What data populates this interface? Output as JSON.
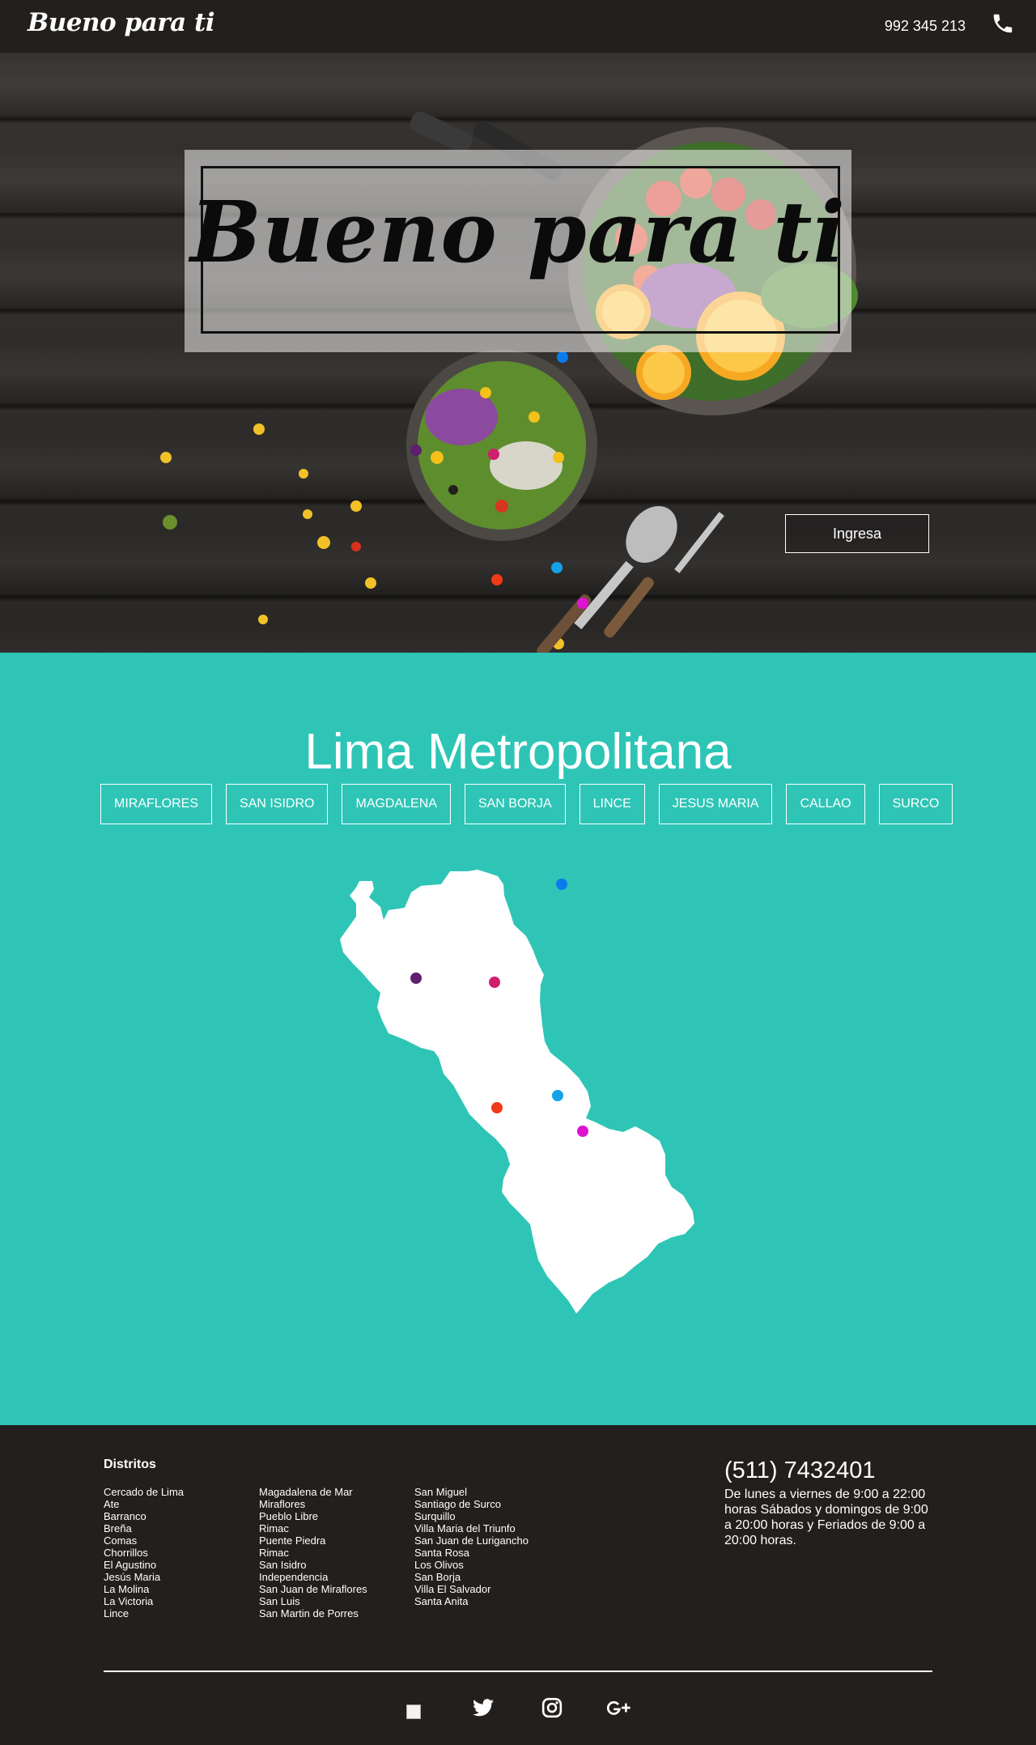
{
  "header": {
    "brand": "Bueno para ti",
    "phone": "992 345 213",
    "phone_icon": "phone-icon"
  },
  "hero": {
    "title": "Bueno para ti",
    "cta_label": "Ingresa"
  },
  "lima": {
    "title": "Lima Metropolitana",
    "districts": [
      "MIRAFLORES",
      "SAN ISIDRO",
      "MAGDALENA",
      "SAN BORJA",
      "LINCE",
      "JESUS MARIA",
      "CALLAO",
      "SURCO"
    ],
    "marker_colors": [
      "#0a7bea",
      "#5e1f6e",
      "#d01f6b",
      "#f03a17",
      "#14a3e8",
      "#e012d2"
    ],
    "background": "#2ec5b6"
  },
  "footer": {
    "heading": "Distritos",
    "columns": [
      [
        "Cercado de Lima",
        "Ate",
        "Barranco",
        "Breña",
        "Comas",
        "Chorrillos",
        "El Agustino",
        "Jesús Maria",
        "La Molina",
        "La Victoria",
        "Lince"
      ],
      [
        "Magadalena de Mar",
        "Miraflores",
        "Pueblo Libre",
        "Rimac",
        "Puente Piedra",
        "Rimac",
        "San Isidro",
        "Independencia",
        "San Juan de Miraflores",
        "San Luis",
        "San Martin de Porres"
      ],
      [
        "San Miguel",
        "Santiago de Surco",
        "Surquillo",
        "Villa Maria del Triunfo",
        "San Juan de Lurigancho",
        "Santa Rosa",
        "Los Olivos",
        "San Borja",
        "Villa El Salvador",
        "Santa Anita"
      ]
    ],
    "contact_phone": "(511) 7432401",
    "contact_hours": "De lunes a viernes de 9:00 a 22:00 horas Sábados y domingos de 9:00 a 20:00 horas y Feriados de 9:00 a 20:00 horas.",
    "social": [
      "facebook-icon",
      "twitter-icon",
      "instagram-icon",
      "google-plus-icon"
    ]
  }
}
